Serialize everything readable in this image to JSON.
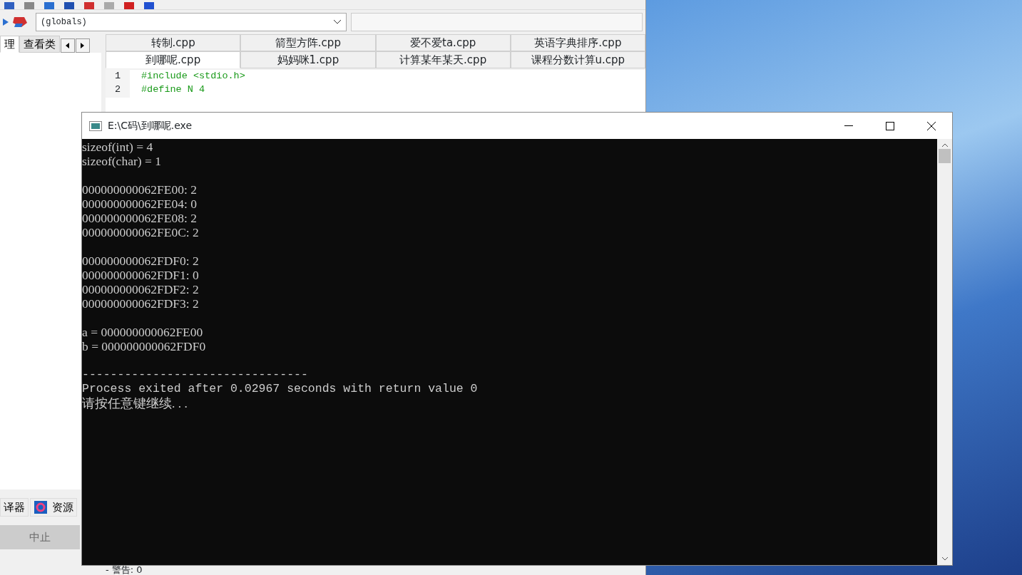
{
  "ide": {
    "scope_dropdown": {
      "value": "(globals)"
    },
    "class_tabs": [
      {
        "label": "理",
        "selected": true
      },
      {
        "label": "查看类",
        "selected": false
      }
    ],
    "file_tab_rows": [
      [
        {
          "label": "转制.cpp",
          "selected": false
        },
        {
          "label": "箭型方阵.cpp",
          "selected": false
        },
        {
          "label": "爱不爱ta.cpp",
          "selected": false
        },
        {
          "label": "英语字典排序.cpp",
          "selected": false
        }
      ],
      [
        {
          "label": "到哪呢.cpp",
          "selected": true
        },
        {
          "label": "妈妈咪1.cpp",
          "selected": false
        },
        {
          "label": "计算某年某天.cpp",
          "selected": false
        },
        {
          "label": "课程分数计算u.cpp",
          "selected": false
        }
      ]
    ],
    "code_lines": [
      {
        "number": "1",
        "text": "#include <stdio.h>",
        "kind": "preprocessor"
      },
      {
        "number": "2",
        "text": "#define N 4",
        "kind": "preprocessor"
      }
    ],
    "bottom_tabs": [
      {
        "label": "译器",
        "selected": false
      },
      {
        "label": "资源",
        "selected": false
      }
    ],
    "abort_button": {
      "label": "中止",
      "disabled": true
    },
    "log_line": "- 警告: 0"
  },
  "console": {
    "title": "E:\\C码\\到哪呢.exe",
    "blocks": [
      [
        "sizeof(int) = 4",
        "sizeof(char) = 1"
      ],
      [
        "000000000062FE00: 2",
        "000000000062FE04: 0",
        "000000000062FE08: 2",
        "000000000062FE0C: 2"
      ],
      [
        "000000000062FDF0: 2",
        "000000000062FDF1: 0",
        "000000000062FDF2: 2",
        "000000000062FDF3: 2"
      ],
      [
        "a = 000000000062FE00",
        "b = 000000000062FDF0"
      ],
      [
        "--------------------------------",
        "Process exited after 0.02967 seconds with return value 0",
        "请按任意键继续. . ."
      ]
    ]
  }
}
